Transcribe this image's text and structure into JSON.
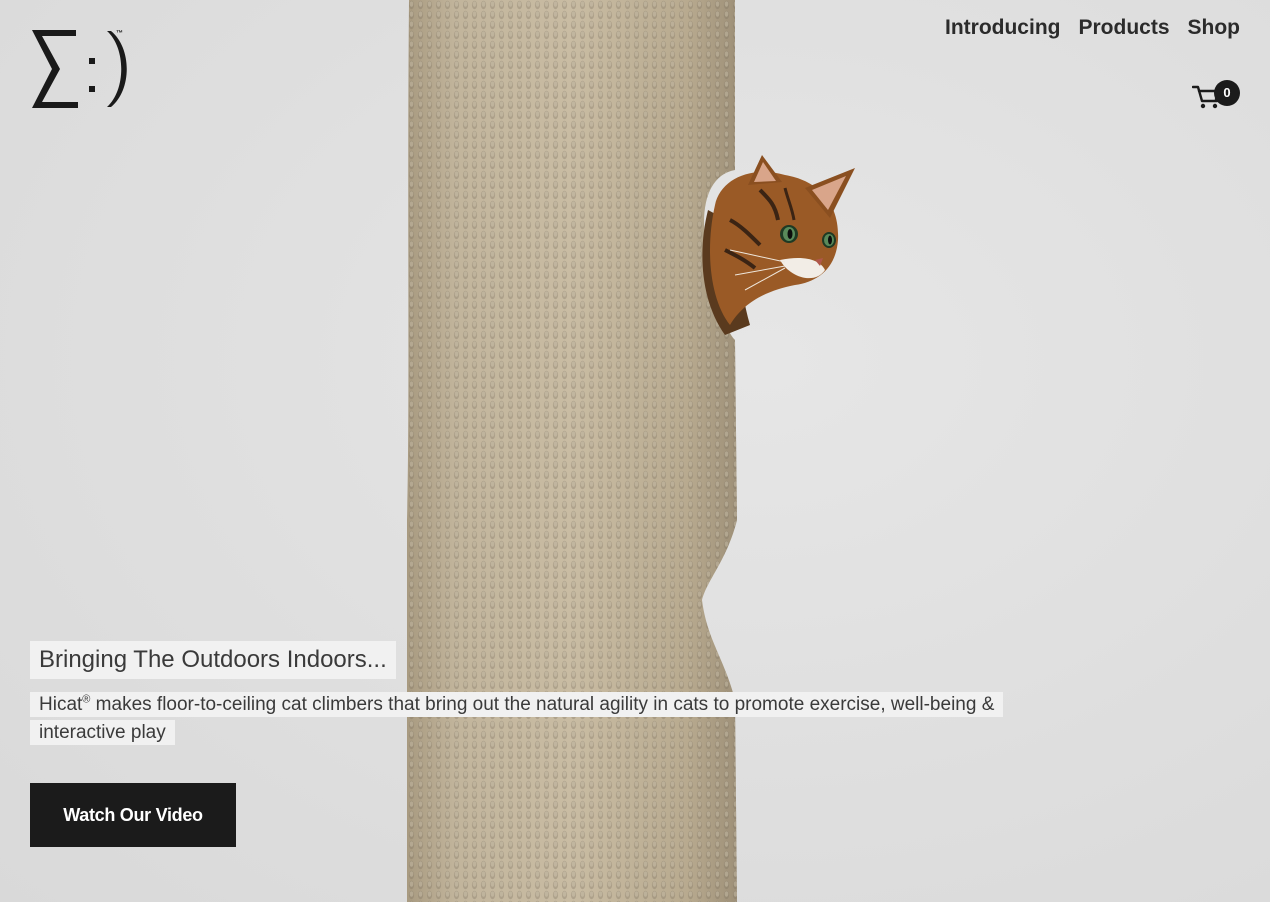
{
  "header": {
    "logo_text": "Σ:)",
    "logo_mark": "™",
    "nav": [
      {
        "label": "Introducing"
      },
      {
        "label": "Products"
      },
      {
        "label": "Shop"
      }
    ],
    "cart": {
      "icon": "cart-icon",
      "count": "0"
    }
  },
  "hero": {
    "title": "Bringing The Outdoors Indoors...",
    "description_brand": "Hicat",
    "description_mark": "®",
    "description_text": " makes floor-to-ceiling cat climbers that bring out the natural agility in cats to promote exercise, well-being & interactive play",
    "button_label": "Watch Our Video"
  },
  "colors": {
    "background": "#e2e2e2",
    "button": "#1b1b1b",
    "post": "#b9ab92",
    "text": "#2b2b2b"
  }
}
